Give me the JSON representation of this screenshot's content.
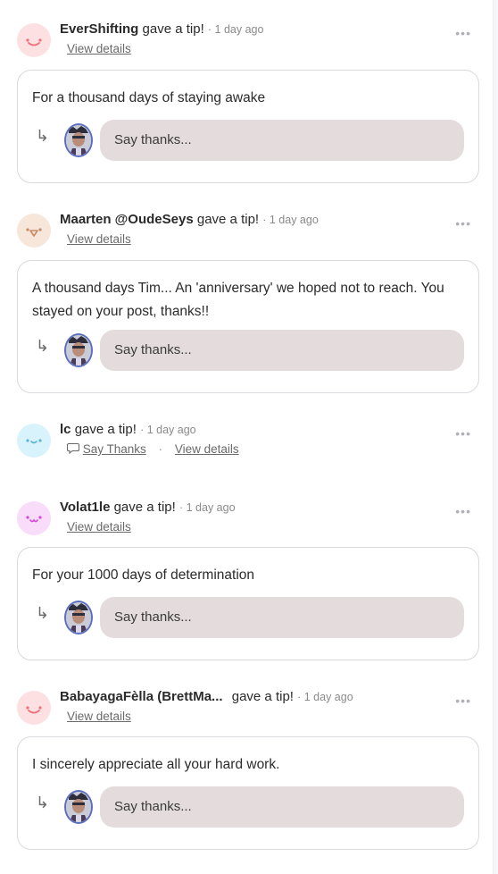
{
  "tips": [
    {
      "name": "EverShifting",
      "action": "gave a tip!",
      "time": "· 1 day ago",
      "details_label": "View details",
      "message": "For a thousand days of staying awake",
      "reply_placeholder": "Say thanks...",
      "avatar_color": "#fde0e2",
      "face_color": "#f0707a"
    },
    {
      "name": "Maarten @OudeSeys",
      "action": "gave a tip!",
      "time": "· 1 day ago",
      "details_label": "View details",
      "message": "A thousand days Tim... An 'anniversary' we hoped not to reach. You stayed on your post, thanks!!",
      "reply_placeholder": "Say thanks...",
      "avatar_color": "#f7e6da",
      "face_color": "#c88a64"
    },
    {
      "name": "lc",
      "action": "gave a tip!",
      "time": "· 1 day ago",
      "say_thanks_label": "Say Thanks",
      "separator": "·",
      "details_label": "View details",
      "avatar_color": "#d8f3fc",
      "face_color": "#5ab6d8"
    },
    {
      "name": "Volat1le",
      "action": "gave a tip!",
      "time": "· 1 day ago",
      "details_label": "View details",
      "message": "For your 1000 days of determination",
      "reply_placeholder": "Say thanks...",
      "avatar_color": "#f9dcf9",
      "face_color": "#d24ad8"
    },
    {
      "name": "BabayagaFèlla (BrettMa...",
      "action": "gave a tip!",
      "time": "· 1 day ago",
      "details_label": "View details",
      "message": "I sincerely appreciate all your hard work.",
      "reply_placeholder": "Say thanks...",
      "avatar_color": "#fde0e2",
      "face_color": "#f0707a"
    }
  ],
  "more_menu_label": "•••",
  "reply_arrow": "↳",
  "accent_colors": {
    "card_border": "#d9d9de",
    "input_background": "#e4dcdc",
    "reply_avatar_border": "#5c6fbf"
  }
}
